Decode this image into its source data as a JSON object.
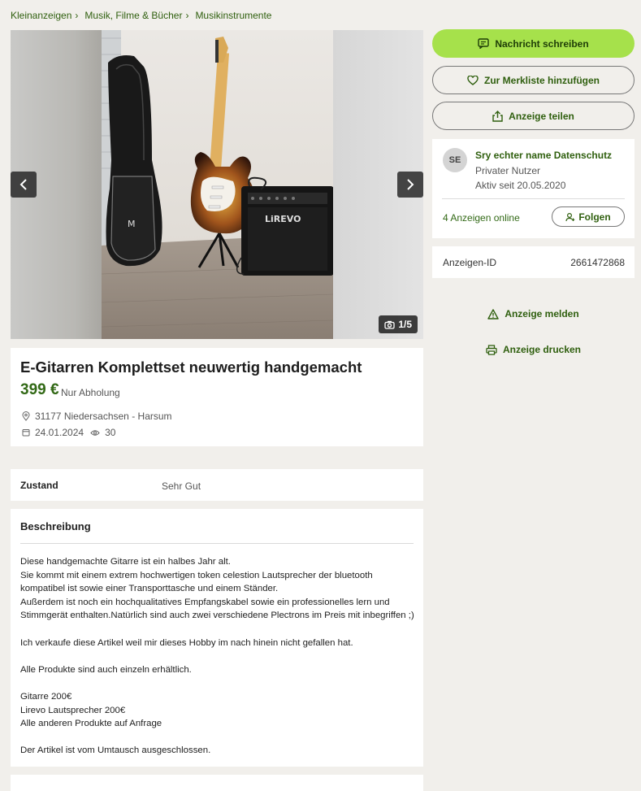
{
  "breadcrumb": [
    "Kleinanzeigen",
    "Musik, Filme & Bücher",
    "Musikinstrumente"
  ],
  "gallery": {
    "counter": "1/5",
    "amp_brand": "LiREVO"
  },
  "listing": {
    "title": "E-Gitarren Komplettset neuwertig handgemacht",
    "price": "399 €",
    "price_note": "Nur Abholung",
    "location": "31177 Niedersachsen - Harsum",
    "date": "24.01.2024",
    "views": "30"
  },
  "details": {
    "label": "Zustand",
    "value": "Sehr Gut"
  },
  "description": {
    "heading": "Beschreibung",
    "lines": [
      "Diese handgemachte Gitarre ist ein halbes Jahr alt.",
      "Sie kommt mit einem extrem hochwertigen token celestion Lautsprecher der bluetooth",
      "kompatibel ist sowie einer Transporttasche und einem Ständer.",
      "Außerdem ist noch ein hochqualitatives Empfangskabel sowie ein professionelles lern und",
      "Stimmgerät enthalten.Natürlich sind auch zwei verschiedene Plectrons im Preis mit inbegriffen ;)",
      "",
      "Ich verkaufe diese Artikel weil mir dieses Hobby im nach hinein nicht gefallen hat.",
      "",
      "Alle Produkte sind auch einzeln erhältlich.",
      "",
      "Gitarre 200€",
      "Lirevo Lautsprecher 200€",
      "Alle anderen Produkte auf Anfrage",
      "",
      "Der Artikel ist vom Umtausch ausgeschlossen."
    ]
  },
  "actions": {
    "message": "Nachricht schreiben",
    "watchlist": "Zur Merkliste hinzufügen",
    "share": "Anzeige teilen"
  },
  "seller": {
    "initials": "SE",
    "name": "Sry echter name Datenschutz",
    "type": "Privater Nutzer",
    "active_since": "Aktiv seit 20.05.2020",
    "ads_online": "4 Anzeigen online",
    "follow": "Folgen"
  },
  "ad_id": {
    "label": "Anzeigen-ID",
    "value": "2661472868"
  },
  "links": {
    "report": "Anzeige melden",
    "print": "Anzeige drucken"
  },
  "colors": {
    "primary": "#a6e14b",
    "brand_green": "#326916",
    "background": "#f1efeb"
  }
}
